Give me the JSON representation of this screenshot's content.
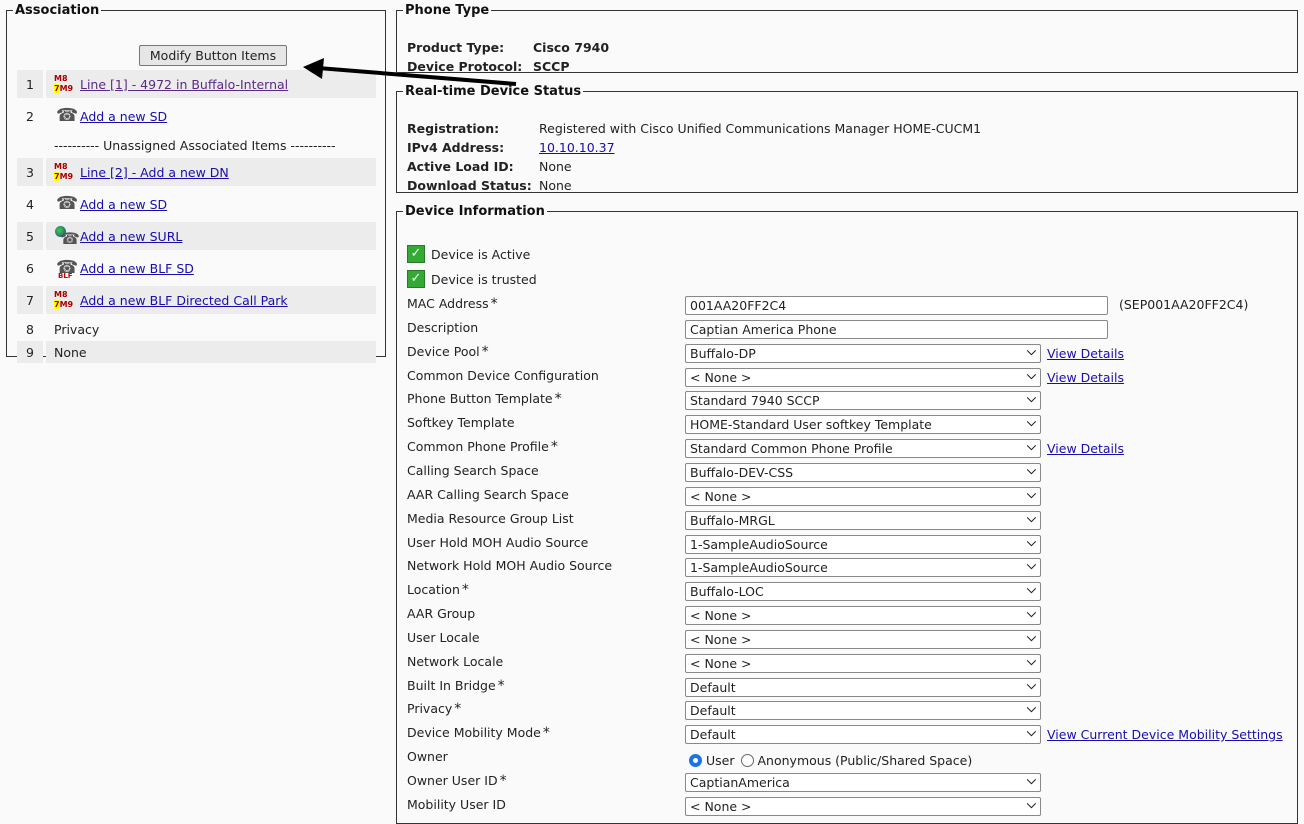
{
  "association": {
    "legend": "Association",
    "modify_button": "Modify Button Items",
    "separator": "---------- Unassigned Associated Items ----------",
    "items": [
      {
        "num": "1",
        "label": "Line [1] - 4972 in Buffalo-Internal",
        "icon": "line",
        "link": true
      },
      {
        "num": "2",
        "label": "Add a new SD",
        "icon": "sd",
        "link": true
      },
      {
        "num": "3",
        "label": "Line [2] - Add a new DN",
        "icon": "line",
        "link": true
      },
      {
        "num": "4",
        "label": "Add a new SD",
        "icon": "sd",
        "link": true
      },
      {
        "num": "5",
        "label": "Add a new SURL",
        "icon": "url",
        "link": true
      },
      {
        "num": "6",
        "label": "Add a new BLF SD",
        "icon": "blf",
        "link": true
      },
      {
        "num": "7",
        "label": "Add a new BLF Directed Call Park",
        "icon": "line",
        "link": true
      },
      {
        "num": "8",
        "label": "Privacy",
        "icon": "",
        "link": false
      },
      {
        "num": "9",
        "label": "None",
        "icon": "",
        "link": false
      }
    ]
  },
  "phone_type": {
    "legend": "Phone Type",
    "product_type_label": "Product Type:",
    "product_type": "Cisco 7940",
    "protocol_label": "Device Protocol:",
    "protocol": "SCCP"
  },
  "status": {
    "legend": "Real-time Device Status",
    "registration_label": "Registration:",
    "registration": "Registered with Cisco Unified Communications Manager HOME-CUCM1",
    "ipv4_label": "IPv4 Address:",
    "ipv4": "10.10.10.37",
    "load_label": "Active Load ID:",
    "load": "None",
    "download_label": "Download Status:",
    "download": "None"
  },
  "device_info": {
    "legend": "Device Information",
    "active_label": "Device is Active",
    "trusted_label": "Device is trusted",
    "rows": [
      {
        "label": "MAC Address",
        "req": true,
        "type": "input",
        "value": "001AA20FF2C4",
        "extra": "(SEP001AA20FF2C4)"
      },
      {
        "label": "Description",
        "req": false,
        "type": "input",
        "value": "Captian America Phone"
      },
      {
        "label": "Device Pool",
        "req": true,
        "type": "select",
        "value": "Buffalo-DP",
        "link": "View Details"
      },
      {
        "label": "Common Device Configuration",
        "req": false,
        "type": "select",
        "value": "< None >",
        "link": "View Details"
      },
      {
        "label": "Phone Button Template",
        "req": true,
        "type": "select",
        "value": "Standard 7940 SCCP"
      },
      {
        "label": "Softkey Template",
        "req": false,
        "type": "select",
        "value": "HOME-Standard User softkey Template"
      },
      {
        "label": "Common Phone Profile",
        "req": true,
        "type": "select",
        "value": "Standard Common Phone Profile",
        "link": "View Details"
      },
      {
        "label": "Calling Search Space",
        "req": false,
        "type": "select",
        "value": "Buffalo-DEV-CSS"
      },
      {
        "label": "AAR Calling Search Space",
        "req": false,
        "type": "select",
        "value": "< None >"
      },
      {
        "label": "Media Resource Group List",
        "req": false,
        "type": "select",
        "value": "Buffalo-MRGL"
      },
      {
        "label": "User Hold MOH Audio Source",
        "req": false,
        "type": "select",
        "value": "1-SampleAudioSource"
      },
      {
        "label": "Network Hold MOH Audio Source",
        "req": false,
        "type": "select",
        "value": "1-SampleAudioSource"
      },
      {
        "label": "Location",
        "req": true,
        "type": "select",
        "value": "Buffalo-LOC"
      },
      {
        "label": "AAR Group",
        "req": false,
        "type": "select",
        "value": "< None >"
      },
      {
        "label": "User Locale",
        "req": false,
        "type": "select",
        "value": "< None >"
      },
      {
        "label": "Network Locale",
        "req": false,
        "type": "select",
        "value": "< None >"
      },
      {
        "label": "Built In Bridge",
        "req": true,
        "type": "select",
        "value": "Default"
      },
      {
        "label": "Privacy",
        "req": true,
        "type": "select",
        "value": "Default"
      },
      {
        "label": "Device Mobility Mode",
        "req": true,
        "type": "select",
        "value": "Default",
        "link": "View Current Device Mobility Settings"
      },
      {
        "label": "Owner",
        "req": false,
        "type": "radio",
        "options": [
          "User",
          "Anonymous (Public/Shared Space)"
        ]
      },
      {
        "label": "Owner User ID",
        "req": true,
        "type": "select",
        "value": "CaptianAmerica"
      },
      {
        "label": "Mobility User ID",
        "req": false,
        "type": "select",
        "value": "< None >"
      }
    ]
  }
}
